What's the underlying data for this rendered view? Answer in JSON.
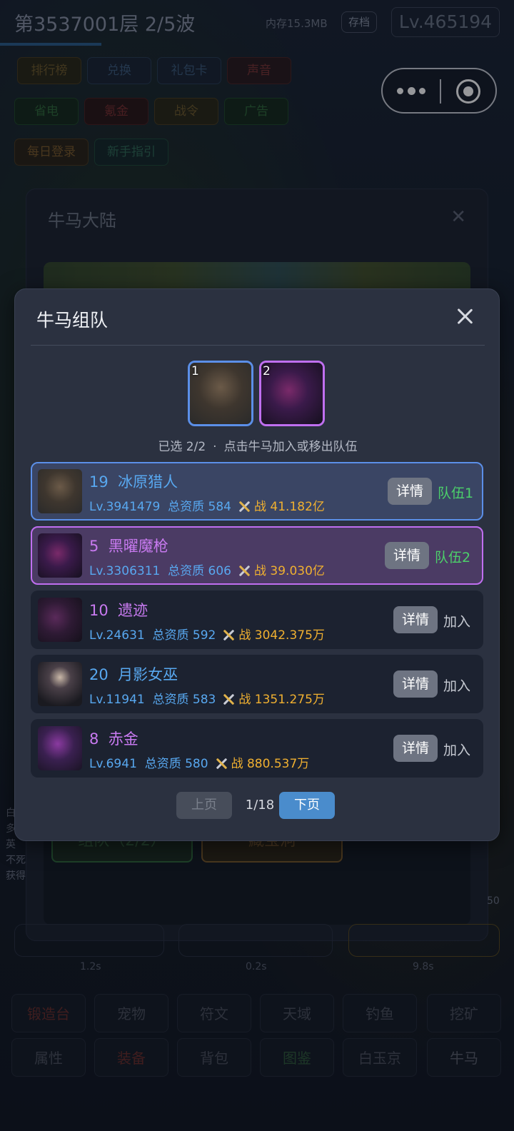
{
  "game": {
    "floor_title": "第3537001层  2/5波",
    "memory": "内存15.3MB",
    "save_label": "存档",
    "level_badge": "Lv.465194",
    "menu_row1": [
      "排行榜",
      "兑换",
      "礼包卡",
      "声音"
    ],
    "menu_row2": [
      "省电",
      "氪金",
      "战令",
      "广告"
    ],
    "menu_row3": [
      "每日登录",
      "新手指引"
    ]
  },
  "background_panel": {
    "title": "牛马大陆",
    "team_button": "组队（2/2）",
    "treasure_button": "藏宝洞",
    "side_text": [
      "白",
      "多",
      "英",
      "不死",
      "获得"
    ],
    "right_num": "50",
    "times": [
      "1.2s",
      "0.2s",
      "9.8s"
    ]
  },
  "bottom_nav": {
    "row1": [
      "锻造台",
      "宠物",
      "符文",
      "天域",
      "钓鱼",
      "挖矿"
    ],
    "row2": [
      "属性",
      "装备",
      "背包",
      "图鉴",
      "白玉京",
      "牛马"
    ]
  },
  "modal": {
    "title": "牛马组队",
    "slots": [
      {
        "num": "1",
        "icon": "hunter-portrait"
      },
      {
        "num": "2",
        "icon": "dark-spear-portrait"
      }
    ],
    "hint_selected": "已选 2/2",
    "hint_dot": "·",
    "hint_action": "点击牛马加入或移出队伍",
    "power_prefix": "战",
    "rows": [
      {
        "id": "19",
        "name": "冰原猎人",
        "level": "Lv.3941479",
        "aptitude": "总资质 584",
        "power": "41.182亿",
        "detail": "详情",
        "status": "队伍1"
      },
      {
        "id": "5",
        "name": "黑曜魔枪",
        "level": "Lv.3306311",
        "aptitude": "总资质 606",
        "power": "39.030亿",
        "detail": "详情",
        "status": "队伍2"
      },
      {
        "id": "10",
        "name": "遗迹",
        "level": "Lv.24631",
        "aptitude": "总资质 592",
        "power": "3042.375万",
        "detail": "详情",
        "status": "加入"
      },
      {
        "id": "20",
        "name": "月影女巫",
        "level": "Lv.11941",
        "aptitude": "总资质 583",
        "power": "1351.275万",
        "detail": "详情",
        "status": "加入"
      },
      {
        "id": "8",
        "name": "赤金",
        "level": "Lv.6941",
        "aptitude": "总资质 580",
        "power": "880.537万",
        "detail": "详情",
        "status": "加入"
      }
    ],
    "pager": {
      "prev": "上页",
      "info": "1/18",
      "next": "下页"
    }
  },
  "colors": {
    "accent_blue": "#4a8ccc",
    "team1_border": "#5b8fe8",
    "team2_border": "#c06ff0",
    "name_blue": "#58a8f0",
    "name_purple": "#c87af0",
    "power_gold": "#f0b030",
    "team_green": "#4cd06a"
  }
}
